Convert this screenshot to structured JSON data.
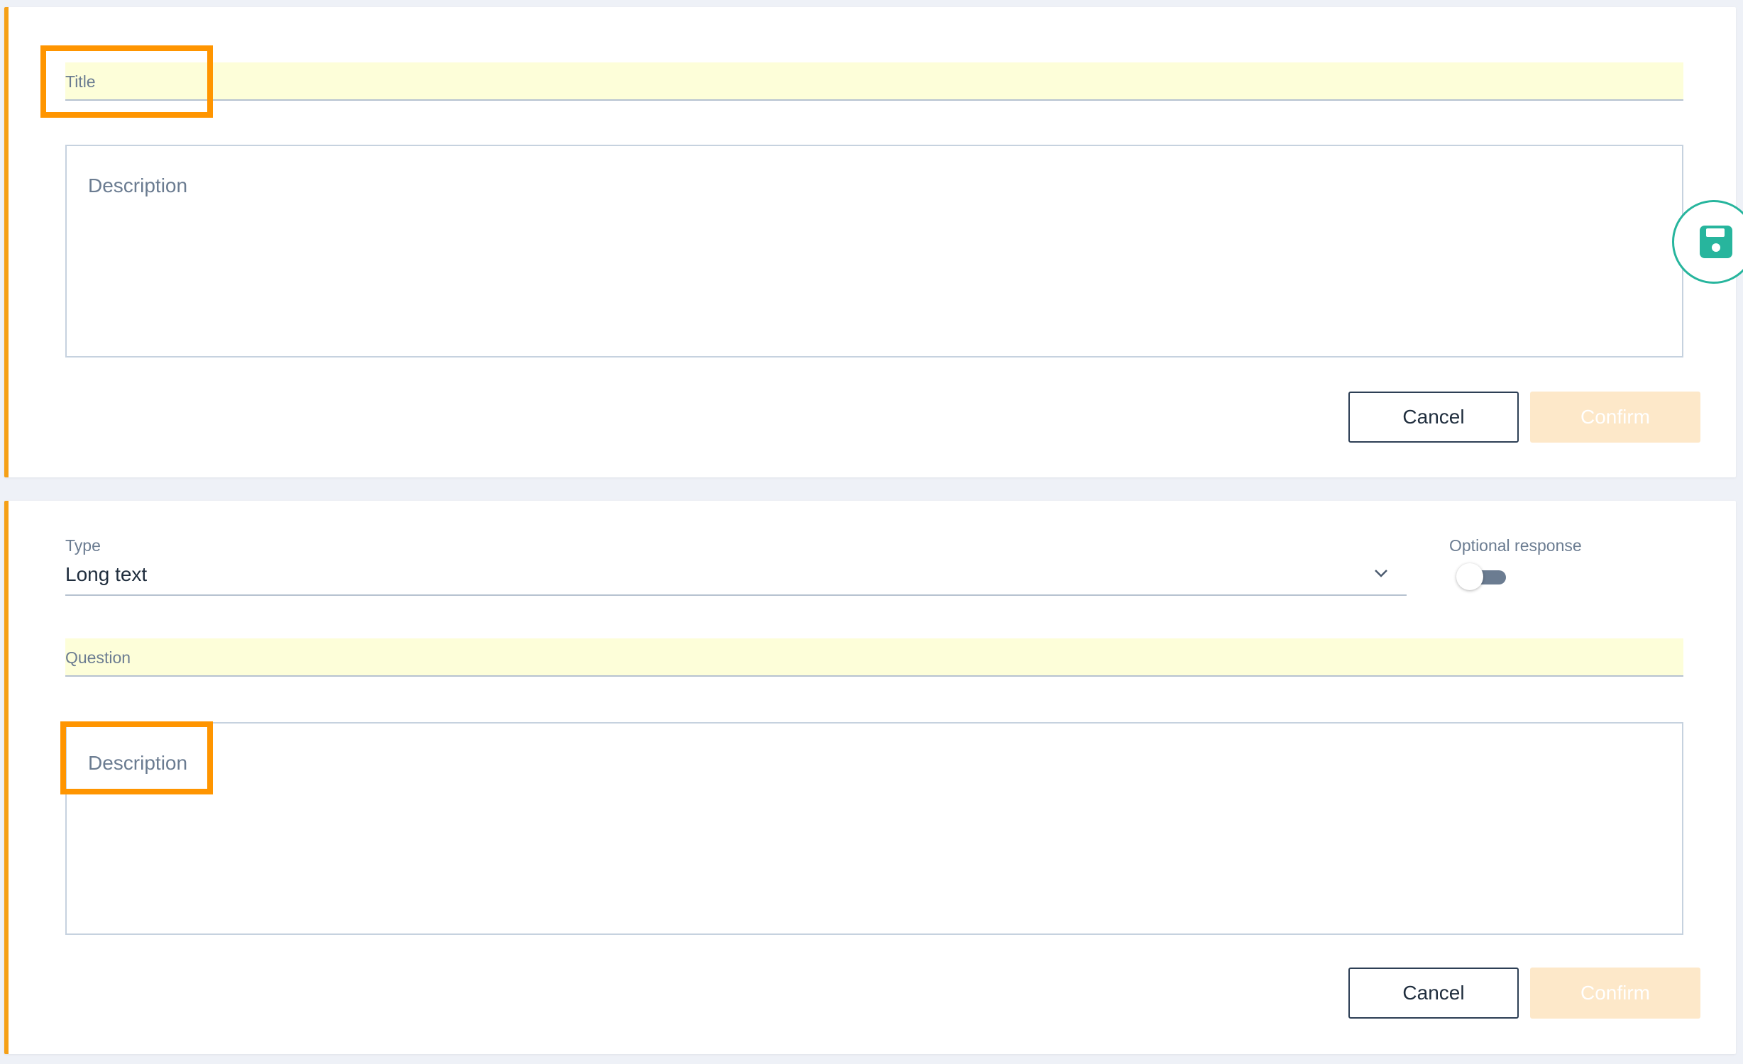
{
  "colors": {
    "accent": "#f5a017",
    "highlight": "#ff9500",
    "save_fab": "#27b59d",
    "field_bg": "#fdfed9"
  },
  "section_1": {
    "title_label": "Title",
    "description_placeholder": "Description",
    "cancel_label": "Cancel",
    "confirm_label": "Confirm"
  },
  "section_2": {
    "type_label": "Type",
    "type_value": "Long text",
    "optional_label": "Optional response",
    "optional_on": false,
    "question_label": "Question",
    "description_placeholder": "Description",
    "cancel_label": "Cancel",
    "confirm_label": "Confirm"
  },
  "icons": {
    "save": "save-icon",
    "dropdown": "chevron-down-icon"
  }
}
